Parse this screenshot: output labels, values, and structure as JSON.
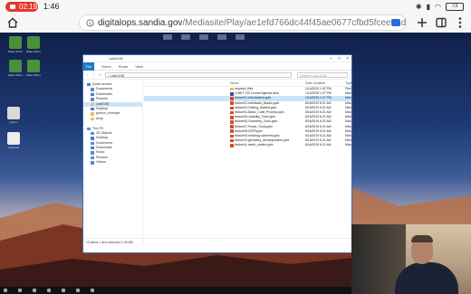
{
  "status_bar": {
    "recording_time": "02:19",
    "clock": "1:46",
    "battery": "73",
    "icons": [
      "wifi-icon",
      "signal-icon",
      "bluetooth-icon"
    ]
  },
  "browser": {
    "url_host": "digitalops.sandia.gov",
    "url_path": "/Mediasite/Play/ae1efd766dc44f45ae0677cfbd5fcee51d",
    "accent": "#2b6ad7"
  },
  "desktop_icons": [
    {
      "label": "Dialer Micro",
      "color": "#4a8f3a"
    },
    {
      "label": "Dialer Micro",
      "color": "#4a8f3a"
    },
    {
      "label": "Dialer Micro",
      "color": "#4a8f3a"
    },
    {
      "label": "Dialer Micro",
      "color": "#4a8f3a"
    },
    {
      "label": "python",
      "color": "#d9d9d9"
    },
    {
      "label": "notebook",
      "color": "#ececec"
    }
  ],
  "explorer": {
    "title": "Lab0108",
    "ribbon": {
      "file": "File",
      "tabs": [
        "Home",
        "Share",
        "View"
      ]
    },
    "address": "› Lab0108",
    "search_placeholder": "Search Lab0108",
    "nav": [
      {
        "label": "Quick access",
        "color": "#3c7fd6",
        "indent": 4
      },
      {
        "label": "Documents",
        "color": "#5d89c9",
        "indent": 8
      },
      {
        "label": "Downloads",
        "color": "#3c7fd6",
        "indent": 8
      },
      {
        "label": "Pictures",
        "color": "#5d89c9",
        "indent": 8
      },
      {
        "label": "Lab0108",
        "color": "#e8c15a",
        "indent": 8,
        "selected": true
      },
      {
        "label": "Desktop",
        "color": "#3c7fd6",
        "indent": 8
      },
      {
        "label": "python_example",
        "color": "#e8c15a",
        "indent": 8
      },
      {
        "label": "temp",
        "color": "#e8c15a",
        "indent": 8
      },
      {
        "label": "",
        "color": "",
        "indent": 0
      },
      {
        "label": "This PC",
        "color": "#5a8fd8",
        "indent": 4
      },
      {
        "label": "3D Objects",
        "color": "#5d89c9",
        "indent": 8
      },
      {
        "label": "Desktop",
        "color": "#3c7fd6",
        "indent": 8
      },
      {
        "label": "Documents",
        "color": "#5d89c9",
        "indent": 8
      },
      {
        "label": "Downloads",
        "color": "#3c7fd6",
        "indent": 8
      },
      {
        "label": "Music",
        "color": "#5d89c9",
        "indent": 8
      },
      {
        "label": "Pictures",
        "color": "#5d89c9",
        "indent": 8
      },
      {
        "label": "Videos",
        "color": "#5d89c9",
        "indent": 8
      }
    ],
    "columns": {
      "name": "Name",
      "date": "Date modified",
      "type": "Type"
    },
    "files": [
      {
        "name": "required_files",
        "date": "1/14/2020 1:32 PM",
        "type": "File folder",
        "color": "#e8c15a"
      },
      {
        "name": "CUBIT 103 Course Agenda.docx",
        "date": "1/14/2020 1:27 PM",
        "type": "Microsoft Word",
        "color": "#2b579a"
      },
      {
        "name": "lecture01-Introduction.pptx",
        "date": "1/14/2020 1:27 PM",
        "type": "Microsoft PowerP...",
        "color": "#d04a2a",
        "selected": true
      },
      {
        "name": "lecture02-Interfaces_Basics.pptx",
        "date": "8/16/2019 6:21 AM",
        "type": "Microsoft PowerP...",
        "color": "#d04a2a"
      },
      {
        "name": "lecture03-Getting_Started.pptx",
        "date": "8/16/2019 6:21 AM",
        "type": "Microsoft PowerP...",
        "color": "#d04a2a"
      },
      {
        "name": "lecture04-Basic_Cubit_Process.pptx",
        "date": "8/16/2019 6:21 AM",
        "type": "Microsoft PowerP...",
        "color": "#d04a2a"
      },
      {
        "name": "lecture05-Usability_Tools.pptx",
        "date": "8/16/2019 6:21 AM",
        "type": "Microsoft PowerP...",
        "color": "#d04a2a"
      },
      {
        "name": "lecture06-Geometry_Tools.pptx",
        "date": "8/16/2019 6:21 AM",
        "type": "Microsoft PowerP...",
        "color": "#d04a2a"
      },
      {
        "name": "lecture07-Power_Tools.pptx",
        "date": "8/16/2019 6:21 AM",
        "type": "Microsoft PowerP...",
        "color": "#d04a2a"
      },
      {
        "name": "lecture08-STEP.pptx",
        "date": "8/16/2019 6:21 AM",
        "type": "Microsoft PowerP...",
        "color": "#d04a2a"
      },
      {
        "name": "lecture09-meshing-schemes.pptx",
        "date": "8/16/2019 6:21 AM",
        "type": "Microsoft PowerP...",
        "color": "#d04a2a"
      },
      {
        "name": "lecture10-geometry_decomposition.pptx",
        "date": "8/16/2019 6:21 AM",
        "type": "Microsoft PowerP...",
        "color": "#d04a2a"
      },
      {
        "name": "lecture11-mesh_control.pptx",
        "date": "8/16/2019 6:21 AM",
        "type": "Microsoft PowerP...",
        "color": "#d04a2a"
      }
    ],
    "status": "13 items   1 item selected  1.06 MB"
  }
}
